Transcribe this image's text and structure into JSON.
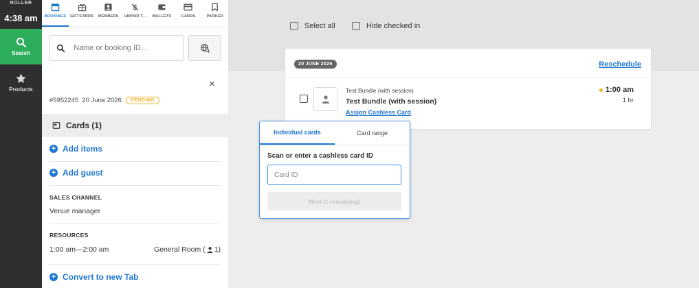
{
  "rail": {
    "brand": "ROLLER",
    "time": "4:38 am",
    "nav": [
      {
        "label": "Search",
        "icon": "search-icon",
        "active": true
      },
      {
        "label": "Products",
        "icon": "star-icon",
        "active": false
      }
    ],
    "active_color": "#2dae5a"
  },
  "panel": {
    "tabs": [
      {
        "label": "BOOKINGS",
        "icon": "calendar-icon",
        "active": true
      },
      {
        "label": "GIFTCARDS",
        "icon": "gift-icon"
      },
      {
        "label": "MEMBERS",
        "icon": "member-icon"
      },
      {
        "label": "UNPAID T...",
        "icon": "no-dollar-icon"
      },
      {
        "label": "WALLETS",
        "icon": "wallet-icon"
      },
      {
        "label": "CARDS",
        "icon": "credit-card-icon"
      },
      {
        "label": "PARKED",
        "icon": "bookmark-icon"
      }
    ],
    "search_placeholder": "Name or booking ID...",
    "close": "×",
    "booking_id": "#5952245",
    "booking_date": "20 June 2026",
    "status": "PENDING",
    "cards_header": "Cards (1)",
    "add_items": "Add items",
    "add_guest": "Add guest",
    "sales_channel_label": "SALES CHANNEL",
    "sales_channel_value": "Venue manager",
    "resources_label": "RESOURCES",
    "resources_time": "1:00 am—2:00 am",
    "resources_room_prefix": "General Room (",
    "resources_room_count": "1)",
    "convert_tab": "Convert to new Tab"
  },
  "main": {
    "select_all": "Select all",
    "hide_checked_in": "Hide checked in",
    "date_pill": "20 JUNE 2026",
    "reschedule": "Reschedule",
    "item": {
      "subtitle": "Test Bundle (with session)",
      "title": "Test Bundle (with session)",
      "assign_link": "Assign Cashless Card",
      "time": "1:00 am",
      "duration": "1 hr"
    }
  },
  "popover": {
    "tabs": [
      {
        "label": "Individual cards",
        "active": true
      },
      {
        "label": "Card range",
        "active": false
      }
    ],
    "label": "Scan or enter a cashless card ID",
    "input_placeholder": "Card ID",
    "next_button": "Next (1 remaining)"
  },
  "colors": {
    "accent": "#1f77d0",
    "pending": "#f0b429"
  }
}
